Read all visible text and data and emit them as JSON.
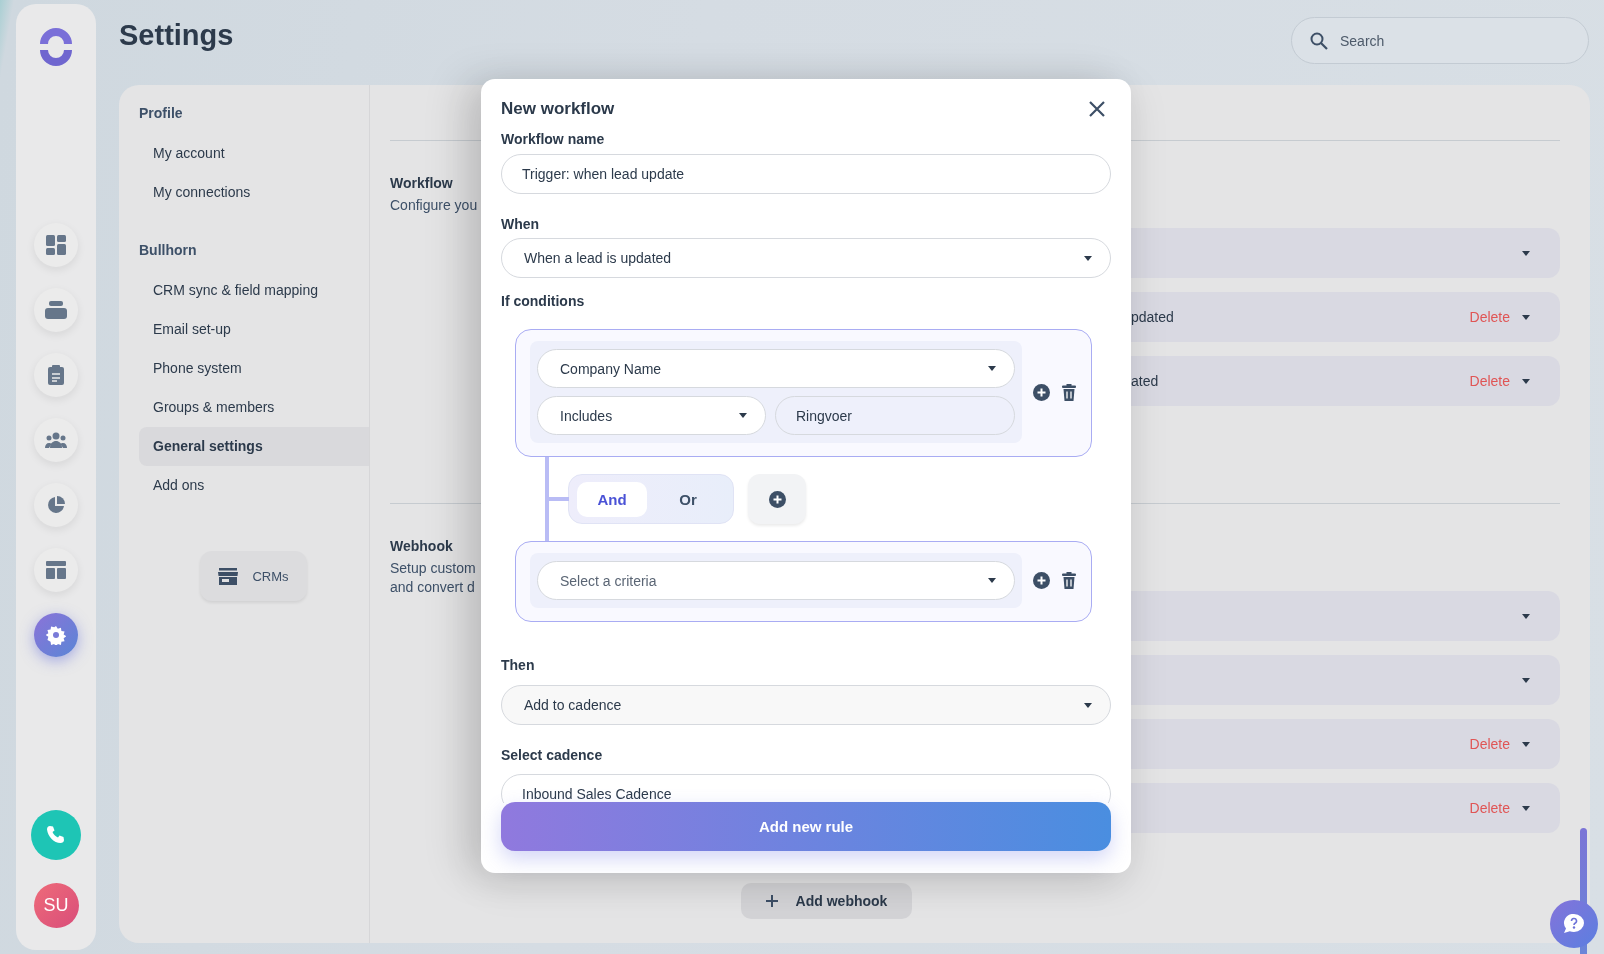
{
  "rail": {
    "items": [
      {
        "kind": "dashboard",
        "selected": false
      },
      {
        "kind": "inbox",
        "selected": false
      },
      {
        "kind": "clipboard",
        "selected": false
      },
      {
        "kind": "people",
        "selected": false
      },
      {
        "kind": "pie",
        "selected": false
      },
      {
        "kind": "layout",
        "selected": false
      },
      {
        "kind": "settings",
        "selected": true
      }
    ],
    "avatar": "SU"
  },
  "header": {
    "title": "Settings",
    "search": {
      "placeholder": "Search"
    }
  },
  "settings_nav": {
    "sections": [
      {
        "heading": "Profile",
        "items": [
          {
            "label": "My account",
            "selected": false
          },
          {
            "label": "My connections",
            "selected": false
          }
        ]
      },
      {
        "heading": "Bullhorn",
        "items": [
          {
            "label": "CRM sync & field mapping",
            "selected": false
          },
          {
            "label": "Email set-up",
            "selected": false
          },
          {
            "label": "Phone system",
            "selected": false
          },
          {
            "label": "Groups & members",
            "selected": false
          },
          {
            "label": "General settings",
            "selected": true
          },
          {
            "label": "Add ons",
            "selected": false
          }
        ]
      }
    ],
    "crms_button": "CRMs"
  },
  "content": {
    "sections": [
      {
        "title": "Workflow",
        "description": [
          "Configure you"
        ],
        "rows": [
          {},
          {
            "label": "pdated",
            "action": "Delete"
          },
          {
            "label": "ated",
            "action": "Delete"
          }
        ]
      },
      {
        "title": "Webhook",
        "description": [
          "Setup custom",
          "and convert d"
        ],
        "rows": [
          {},
          {},
          {
            "action": "Delete"
          },
          {
            "action": "Delete"
          }
        ],
        "add_button": "Add webhook"
      }
    ]
  },
  "modal": {
    "title": "New workflow",
    "workflow_name": {
      "label": "Workflow name",
      "value": "Trigger: when lead update"
    },
    "when": {
      "label": "When",
      "value": "When a lead is updated"
    },
    "conditions": {
      "label": "If conditions",
      "groups": [
        {
          "criteria": {
            "value": "Company Name"
          },
          "operator": {
            "value": "Includes"
          },
          "match": {
            "value": "Ringvoer"
          }
        },
        {
          "criteria": {
            "placeholder": "Select a criteria"
          }
        }
      ],
      "connector": {
        "options": [
          {
            "label": "And",
            "selected": true
          },
          {
            "label": "Or",
            "selected": false
          }
        ]
      }
    },
    "then": {
      "label": "Then",
      "value": "Add to cadence"
    },
    "select_cadence": {
      "label": "Select cadence",
      "value": "Inbound Sales Cadence"
    },
    "submit": "Add new rule"
  }
}
